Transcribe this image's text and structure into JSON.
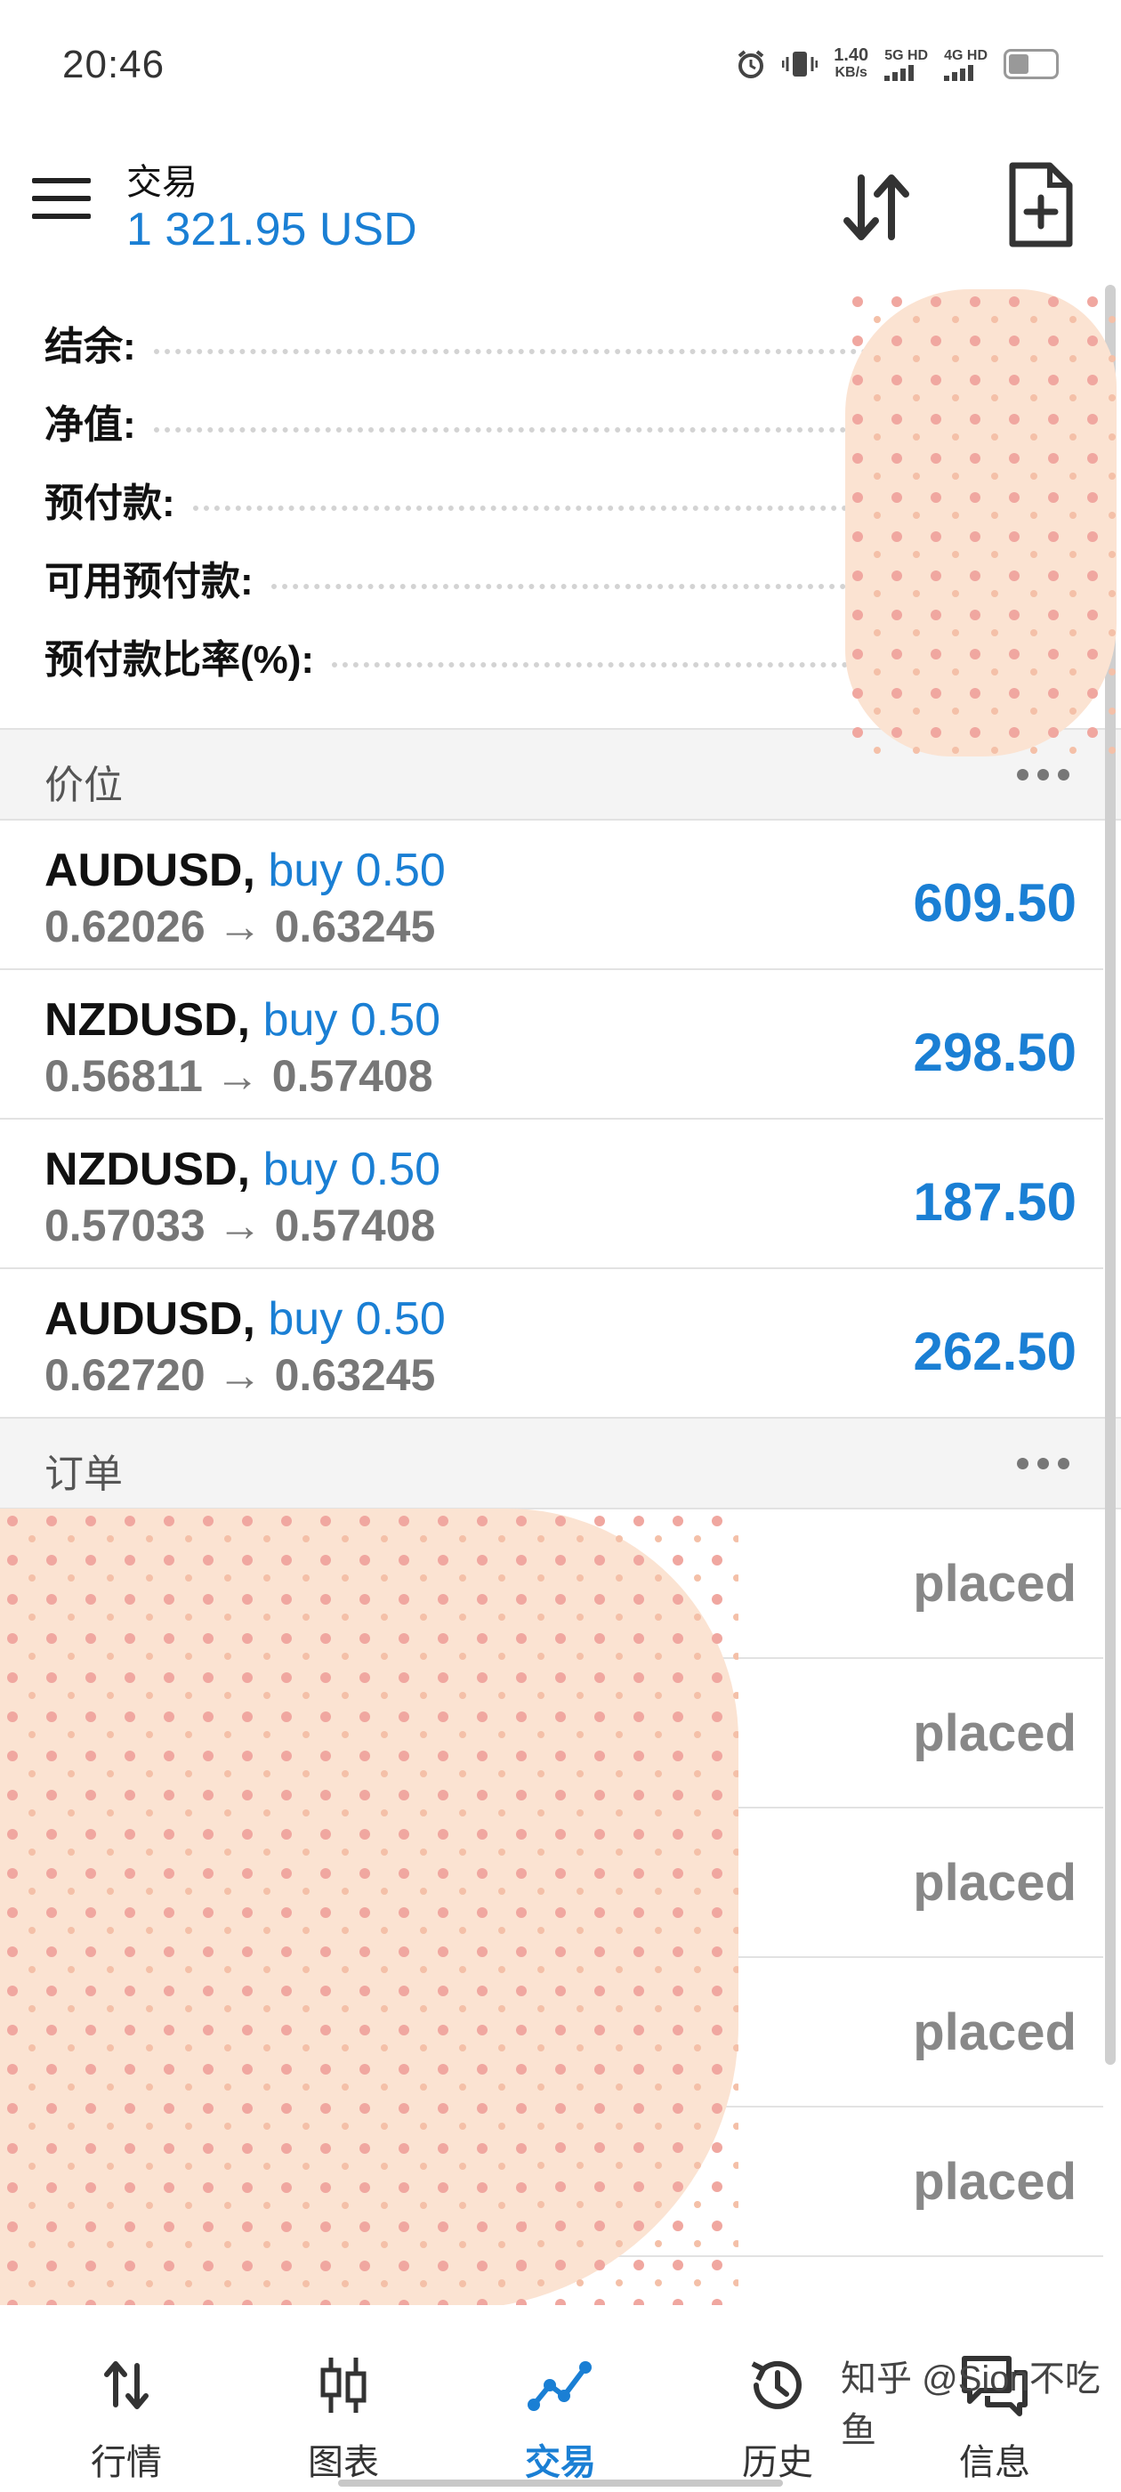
{
  "status_bar": {
    "time": "20:46",
    "speed_value": "1.40",
    "speed_unit": "KB/s",
    "net1": "5G HD",
    "net2": "4G HD"
  },
  "header": {
    "title": "交易",
    "balance": "1 321.95 USD"
  },
  "summary": {
    "balance_label": "结余:",
    "equity_label": "净值:",
    "margin_label": "预付款:",
    "free_margin_label": "可用预付款:",
    "margin_level_label": "预付款比率(%):"
  },
  "positions": {
    "title": "价位",
    "rows": [
      {
        "symbol": "AUDUSD,",
        "side": "buy 0.50",
        "open": "0.62026",
        "current": "0.63245",
        "profit": "609.50"
      },
      {
        "symbol": "NZDUSD,",
        "side": "buy 0.50",
        "open": "0.56811",
        "current": "0.57408",
        "profit": "298.50"
      },
      {
        "symbol": "NZDUSD,",
        "side": "buy 0.50",
        "open": "0.57033",
        "current": "0.57408",
        "profit": "187.50"
      },
      {
        "symbol": "AUDUSD,",
        "side": "buy 0.50",
        "open": "0.62720",
        "current": "0.63245",
        "profit": "262.50"
      }
    ],
    "arrow": "→"
  },
  "orders": {
    "title": "订单",
    "rows": [
      {
        "status": "placed"
      },
      {
        "status": "placed"
      },
      {
        "status": "placed"
      },
      {
        "status": "placed"
      },
      {
        "status": "placed"
      }
    ]
  },
  "nav": {
    "quotes": "行情",
    "chart": "图表",
    "trade": "交易",
    "history": "历史",
    "messages": "信息"
  },
  "watermark": "知乎 @Sion不吃鱼",
  "colors": {
    "accent": "#1a7fd4",
    "muted": "#777777",
    "redaction": "#fbe3d2"
  }
}
